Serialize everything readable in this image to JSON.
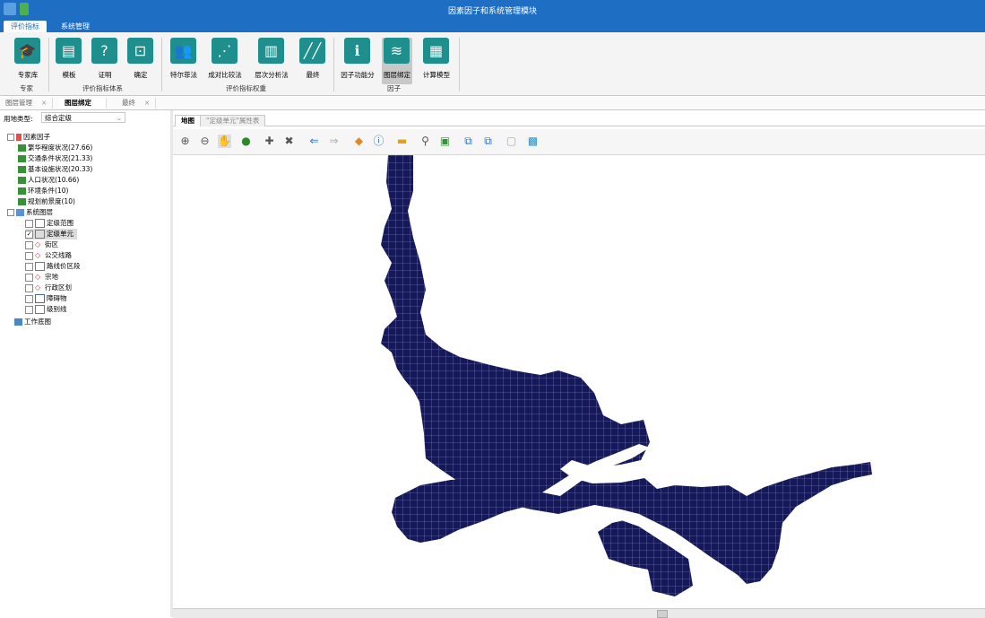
{
  "title": "因素因子和系统管理模块",
  "menu_tabs": [
    "评价指标",
    "系统管理"
  ],
  "ribbon": {
    "buttons": [
      {
        "label": "专家库",
        "icon": "expert-icon"
      },
      {
        "label": "模板",
        "icon": "template-icon"
      },
      {
        "label": "证明",
        "icon": "proof-icon"
      },
      {
        "label": "确定",
        "icon": "confirm-icon"
      },
      {
        "label": "特尔菲法",
        "icon": "delphi-icon"
      },
      {
        "label": "成对比较法",
        "icon": "pairwise-icon"
      },
      {
        "label": "层次分析法",
        "icon": "ahp-icon"
      },
      {
        "label": "最终",
        "icon": "final-icon"
      },
      {
        "label": "因子功能分",
        "icon": "factor-score-icon"
      },
      {
        "label": "图层绑定",
        "icon": "layer-bind-icon"
      },
      {
        "label": "计算模型",
        "icon": "calculator-icon"
      }
    ],
    "groups": [
      "专家",
      "评价指标体系",
      "评价指标权重",
      "因子"
    ]
  },
  "doc_tabs": [
    {
      "label": "图层管理",
      "close": "×"
    },
    {
      "label": "图层绑定",
      "close": ""
    },
    {
      "label": "最终",
      "close": "×"
    }
  ],
  "land_type": {
    "label": "用地类型:",
    "value": "综合定级"
  },
  "tree": {
    "root1": "因素因子",
    "factors": [
      "繁华程度状况(27.66)",
      "交通条件状况(21.33)",
      "基本设施状况(20.33)",
      "人口状况(10.66)",
      "环境条件(10)",
      "规划前景度(10)"
    ],
    "root2": "系统图层",
    "layers": [
      "定级范围",
      "定级单元",
      "街区",
      "公交线路",
      "路线价区段",
      "宗地",
      "行政区划",
      "障碍物",
      "级别线"
    ],
    "root3": "工作底图"
  },
  "map_tabs": [
    "地图",
    "\"定级单元\"属性表"
  ],
  "colors": {
    "accent": "#1e6fc4",
    "map_fill": "#15195a",
    "icon_teal": "#1e8f8c"
  }
}
